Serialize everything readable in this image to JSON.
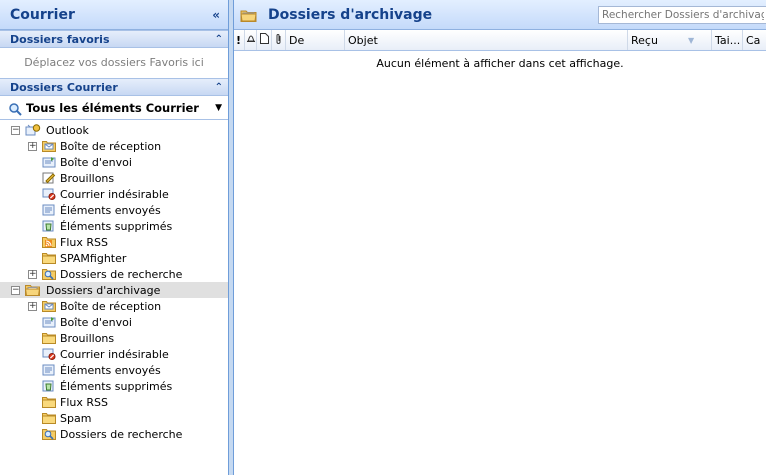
{
  "nav": {
    "title": "Courrier",
    "collapse_glyph": "«",
    "favorites": {
      "title": "Dossiers favoris",
      "hint": "Déplacez vos dossiers Favoris ici"
    },
    "mail_folders": {
      "title": "Dossiers Courrier",
      "view_selector": "Tous les éléments Courrier"
    },
    "tree": [
      {
        "label": "Outlook",
        "level": 0,
        "expander": "−",
        "icon": "outlook-root-icon",
        "selected": false
      },
      {
        "label": "Boîte de réception",
        "level": 1,
        "expander": "+",
        "icon": "inbox-icon",
        "selected": false
      },
      {
        "label": "Boîte d'envoi",
        "level": 1,
        "expander": "",
        "icon": "outbox-icon",
        "selected": false
      },
      {
        "label": "Brouillons",
        "level": 1,
        "expander": "",
        "icon": "drafts-icon",
        "selected": false
      },
      {
        "label": "Courrier indésirable",
        "level": 1,
        "expander": "",
        "icon": "junk-icon",
        "selected": false
      },
      {
        "label": "Éléments envoyés",
        "level": 1,
        "expander": "",
        "icon": "sent-icon",
        "selected": false
      },
      {
        "label": "Éléments supprimés",
        "level": 1,
        "expander": "",
        "icon": "deleted-icon",
        "selected": false
      },
      {
        "label": "Flux RSS",
        "level": 1,
        "expander": "",
        "icon": "rss-icon",
        "selected": false
      },
      {
        "label": "SPAMfighter",
        "level": 1,
        "expander": "",
        "icon": "folder-icon",
        "selected": false
      },
      {
        "label": "Dossiers de recherche",
        "level": 1,
        "expander": "+",
        "icon": "search-folder-icon",
        "selected": false
      },
      {
        "label": "Dossiers d'archivage",
        "level": 0,
        "expander": "−",
        "icon": "archive-root-icon",
        "selected": true
      },
      {
        "label": "Boîte de réception",
        "level": 1,
        "expander": "+",
        "icon": "inbox-icon",
        "selected": false
      },
      {
        "label": "Boîte d'envoi",
        "level": 1,
        "expander": "",
        "icon": "outbox-icon",
        "selected": false
      },
      {
        "label": "Brouillons",
        "level": 1,
        "expander": "",
        "icon": "folder-icon",
        "selected": false
      },
      {
        "label": "Courrier indésirable",
        "level": 1,
        "expander": "",
        "icon": "junk-icon",
        "selected": false
      },
      {
        "label": "Éléments envoyés",
        "level": 1,
        "expander": "",
        "icon": "sent-icon",
        "selected": false
      },
      {
        "label": "Éléments supprimés",
        "level": 1,
        "expander": "",
        "icon": "deleted-icon",
        "selected": false
      },
      {
        "label": "Flux RSS",
        "level": 1,
        "expander": "",
        "icon": "folder-icon",
        "selected": false
      },
      {
        "label": "Spam",
        "level": 1,
        "expander": "",
        "icon": "folder-icon",
        "selected": false
      },
      {
        "label": "Dossiers de recherche",
        "level": 1,
        "expander": "",
        "icon": "search-folder-icon",
        "selected": false
      }
    ]
  },
  "main": {
    "title": "Dossiers d'archivage",
    "search_placeholder": "Rechercher Dossiers d'archivage",
    "columns": {
      "importance": "!",
      "from": "De",
      "subject": "Objet",
      "received": "Reçu",
      "size": "Tai...",
      "category": "Ca"
    },
    "empty_message": "Aucun élément à afficher dans cet affichage."
  },
  "colors": {
    "header_text": "#15428b",
    "pane_border": "#6f9dd9",
    "selected_row": "#e0e0e0"
  }
}
